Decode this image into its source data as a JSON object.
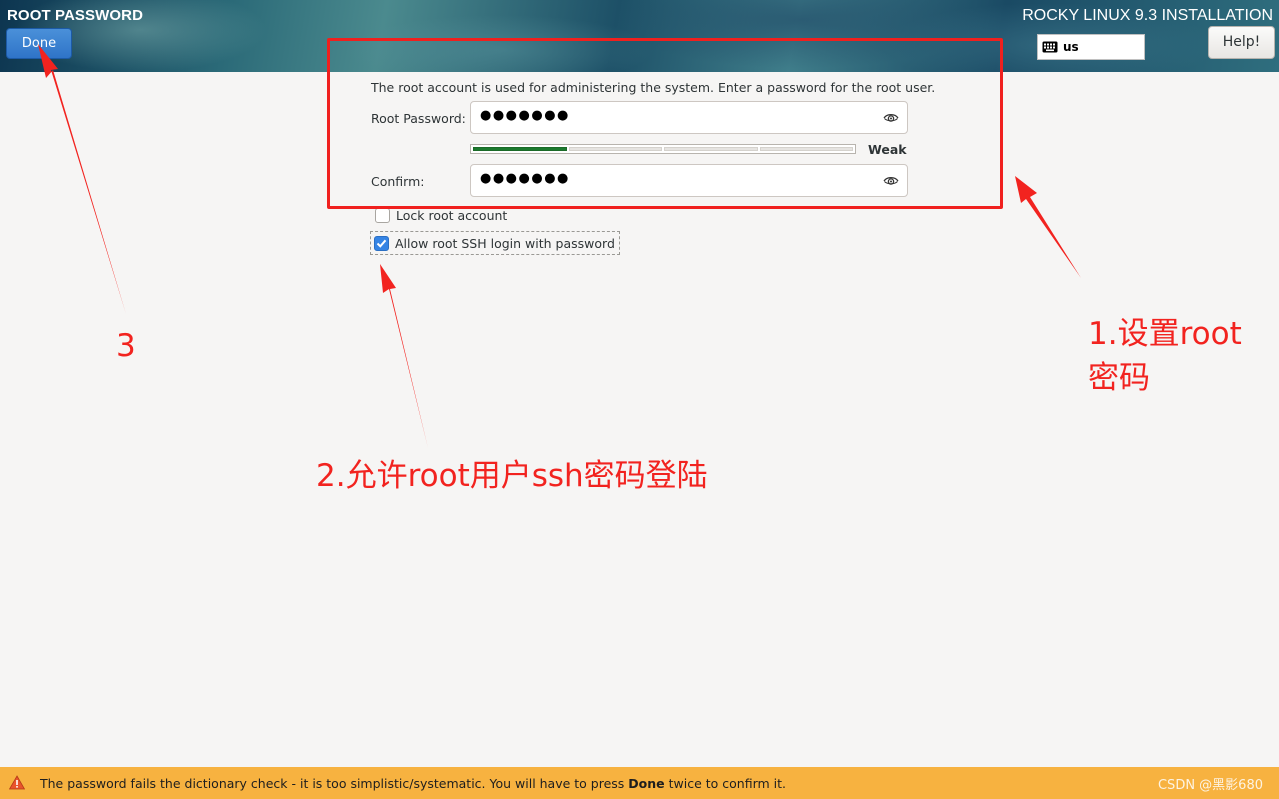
{
  "header": {
    "spoke_title": "ROOT PASSWORD",
    "done_label": "Done",
    "product_title": "ROCKY LINUX 9.3 INSTALLATION",
    "keyboard_layout": "us",
    "help_label": "Help!"
  },
  "form": {
    "intro": "The root account is used for administering the system.  Enter a password for the root user.",
    "root_password_label": "Root Password:",
    "root_password_value": "●●●●●●●",
    "strength_fraction": 0.25,
    "strength_label": "Weak",
    "confirm_label": "Confirm:",
    "confirm_value": "●●●●●●●",
    "lock_root_label": "Lock root account",
    "lock_root_checked": false,
    "allow_ssh_label": "Allow root SSH login with password",
    "allow_ssh_checked": true
  },
  "annotations": {
    "step1_line1": "1.设置root",
    "step1_line2": "密码",
    "step2": "2.允许root用户ssh密码登陆",
    "step3": "3",
    "color": "#f2231f"
  },
  "status": {
    "message_pre": "The password fails the dictionary check - it is too simplistic/systematic. You will have to press ",
    "message_bold": "Done",
    "message_post": " twice to confirm it.",
    "watermark": "CSDN @黑影680",
    "bar_color": "#f7b240"
  },
  "colors": {
    "accent": "#3584e4",
    "strength_weak": "#1b7a2e"
  }
}
